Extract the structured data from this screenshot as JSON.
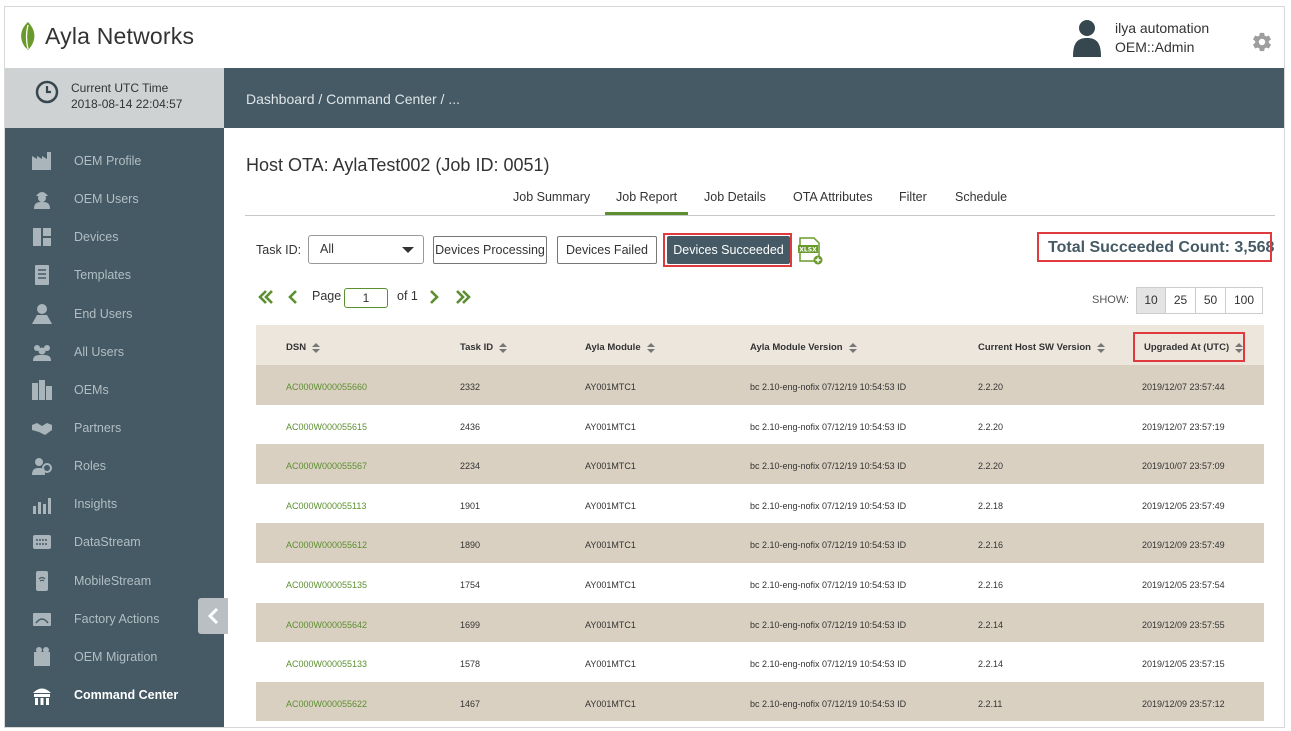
{
  "header": {
    "brand": "Ayla Networks",
    "user_name": "ilya automation",
    "user_role": "OEM::Admin"
  },
  "clock": {
    "label": "Current UTC Time",
    "value": "2018-08-14 22:04:57"
  },
  "sidebar": {
    "items": [
      {
        "label": "OEM Profile",
        "icon": "factory-icon"
      },
      {
        "label": "OEM Users",
        "icon": "worker-icon"
      },
      {
        "label": "Devices",
        "icon": "devices-icon"
      },
      {
        "label": "Templates",
        "icon": "template-icon"
      },
      {
        "label": "End Users",
        "icon": "end-user-icon"
      },
      {
        "label": "All Users",
        "icon": "users-group-icon"
      },
      {
        "label": "OEMs",
        "icon": "buildings-icon"
      },
      {
        "label": "Partners",
        "icon": "handshake-icon"
      },
      {
        "label": "Roles",
        "icon": "roles-icon"
      },
      {
        "label": "Insights",
        "icon": "chart-icon"
      },
      {
        "label": "DataStream",
        "icon": "datastream-icon"
      },
      {
        "label": "MobileStream",
        "icon": "mobile-icon"
      },
      {
        "label": "Factory Actions",
        "icon": "factory-actions-icon"
      },
      {
        "label": "OEM Migration",
        "icon": "migration-icon"
      },
      {
        "label": "Command Center",
        "icon": "command-center-icon",
        "active": true
      }
    ]
  },
  "breadcrumb": "Dashboard / Command Center / ...",
  "page": {
    "title": "Host OTA: AylaTest002 (Job ID: 0051)",
    "tabs": [
      "Job Summary",
      "Job Report",
      "Job Details",
      "OTA Attributes",
      "Filter",
      "Schedule"
    ],
    "active_tab": "Job Report"
  },
  "filters": {
    "task_id_label": "Task ID:",
    "task_id_value": "All",
    "buttons": [
      "Devices Processing",
      "Devices Failed",
      "Devices Succeeded"
    ],
    "active_button": "Devices Succeeded",
    "total_label": "Total Succeeded Count: 3,568"
  },
  "pagination": {
    "page_label": "Page",
    "page_value": "1",
    "of_label": "of 1",
    "show_label": "SHOW:",
    "sizes": [
      "10",
      "25",
      "50",
      "100"
    ],
    "active_size": "10"
  },
  "table": {
    "columns": [
      "DSN",
      "Task ID",
      "Ayla Module",
      "Ayla Module Version",
      "Current Host SW Version",
      "Upgraded At (UTC)"
    ],
    "rows": [
      [
        "AC000W000055660",
        "2332",
        "AY001MTC1",
        "bc 2.10-eng-nofix 07/12/19 10:54:53 ID",
        "2.2.20",
        "2019/12/07 23:57:44"
      ],
      [
        "AC000W000055615",
        "2436",
        "AY001MTC1",
        "bc 2.10-eng-nofix 07/12/19 10:54:53 ID",
        "2.2.20",
        "2019/12/07 23:57:19"
      ],
      [
        "AC000W000055567",
        "2234",
        "AY001MTC1",
        "bc 2.10-eng-nofix 07/12/19 10:54:53 ID",
        "2.2.20",
        "2019/10/07 23:57:09"
      ],
      [
        "AC000W000055113",
        "1901",
        "AY001MTC1",
        "bc 2.10-eng-nofix 07/12/19 10:54:53 ID",
        "2.2.18",
        "2019/12/05 23:57:49"
      ],
      [
        "AC000W000055612",
        "1890",
        "AY001MTC1",
        "bc 2.10-eng-nofix 07/12/19 10:54:53 ID",
        "2.2.16",
        "2019/12/09 23:57:49"
      ],
      [
        "AC000W000055135",
        "1754",
        "AY001MTC1",
        "bc 2.10-eng-nofix 07/12/19 10:54:53 ID",
        "2.2.16",
        "2019/12/05 23:57:54"
      ],
      [
        "AC000W000055642",
        "1699",
        "AY001MTC1",
        "bc 2.10-eng-nofix 07/12/19 10:54:53 ID",
        "2.2.14",
        "2019/12/09 23:57:55"
      ],
      [
        "AC000W000055133",
        "1578",
        "AY001MTC1",
        "bc 2.10-eng-nofix 07/12/19 10:54:53 ID",
        "2.2.14",
        "2019/12/05 23:57:15"
      ],
      [
        "AC000W000055622",
        "1467",
        "AY001MTC1",
        "bc 2.10-eng-nofix 07/12/19 10:54:53 ID",
        "2.2.11",
        "2019/12/09 23:57:12"
      ]
    ]
  },
  "colors": {
    "brand_green": "#5b8f2f",
    "nav_dark": "#455a64",
    "highlight_red": "#e0393e"
  }
}
